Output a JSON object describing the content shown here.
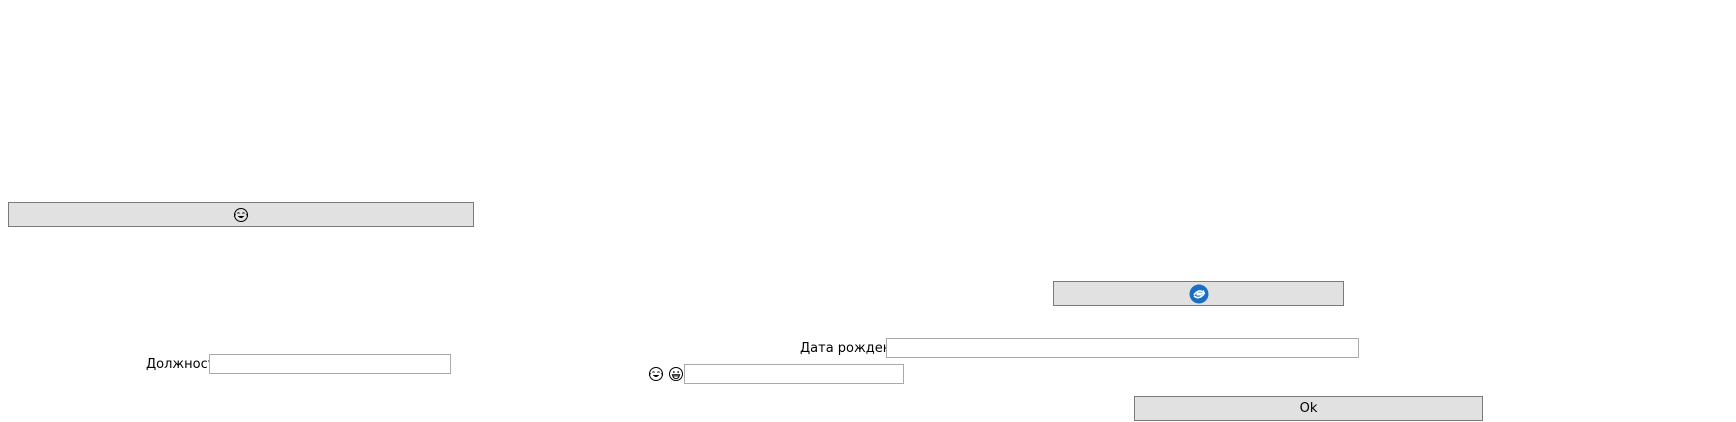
{
  "form": {
    "top_button": {
      "icon": "face-with-tears-of-joy-icon"
    },
    "middle_button": {
      "icon": "blue-rotate-logo-icon",
      "icon_color": "#1a6fc4"
    },
    "position_field": {
      "label": "Должность",
      "value": ""
    },
    "birthdate_field": {
      "label": "Дата рождения",
      "value": ""
    },
    "emoji_field": {
      "label_icons": [
        "face-with-tears-of-joy-icon",
        "grinning-face-icon"
      ],
      "value": ""
    },
    "ok_button": {
      "label": "Ok"
    }
  },
  "colors": {
    "button_bg": "#e1e1e1",
    "button_border": "#7a7a7a",
    "input_border": "#a9a9a9"
  }
}
